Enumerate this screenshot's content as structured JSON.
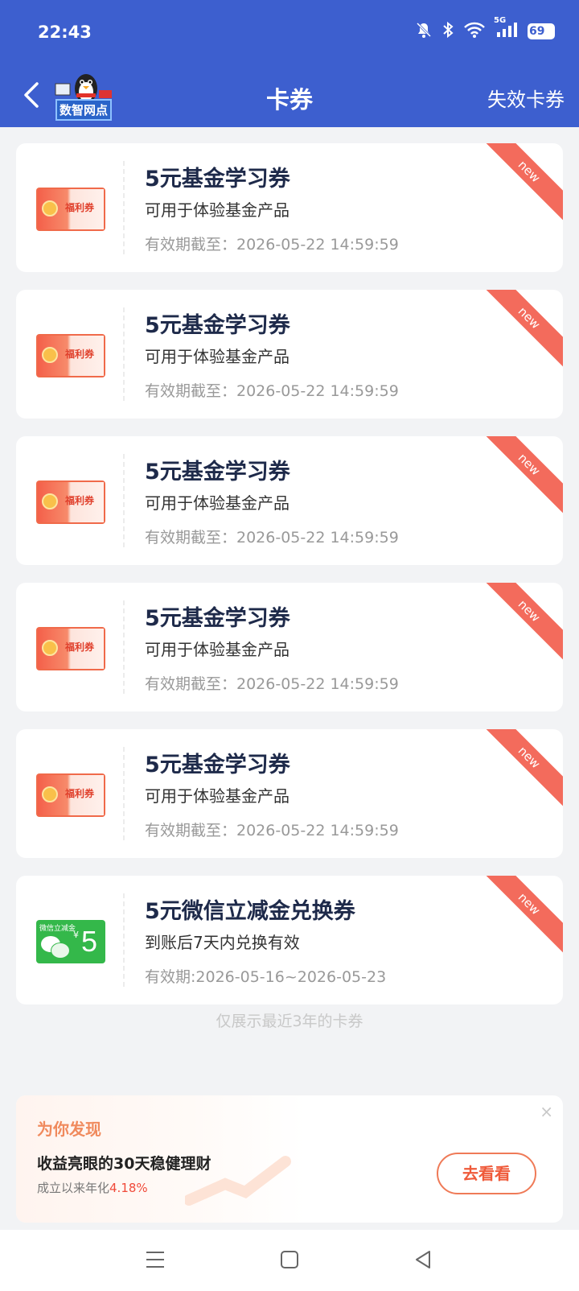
{
  "status_bar": {
    "time": "22:43",
    "network": "5G",
    "battery": "69"
  },
  "header": {
    "title": "卡券",
    "right_link": "失效卡券",
    "logo_text": "数智网点"
  },
  "coupons": [
    {
      "title": "5元基金学习券",
      "desc": "可用于体验基金产品",
      "expiry": "有效期截至：2026-05-22 14:59:59",
      "badge": "new",
      "image_label": "福利券",
      "image_type": "red"
    },
    {
      "title": "5元基金学习券",
      "desc": "可用于体验基金产品",
      "expiry": "有效期截至：2026-05-22 14:59:59",
      "badge": "new",
      "image_label": "福利券",
      "image_type": "red"
    },
    {
      "title": "5元基金学习券",
      "desc": "可用于体验基金产品",
      "expiry": "有效期截至：2026-05-22 14:59:59",
      "badge": "new",
      "image_label": "福利券",
      "image_type": "red"
    },
    {
      "title": "5元基金学习券",
      "desc": "可用于体验基金产品",
      "expiry": "有效期截至：2026-05-22 14:59:59",
      "badge": "new",
      "image_label": "福利券",
      "image_type": "red"
    },
    {
      "title": "5元基金学习券",
      "desc": "可用于体验基金产品",
      "expiry": "有效期截至：2026-05-22 14:59:59",
      "badge": "new",
      "image_label": "福利券",
      "image_type": "red"
    },
    {
      "title": "5元微信立减金兑换券",
      "desc": "到账后7天内兑换有效",
      "expiry": "有效期:2026-05-16~2026-05-23",
      "badge": "new",
      "image_label": "微信立减金",
      "image_value": "5",
      "image_currency": "¥",
      "image_type": "green"
    }
  ],
  "footer_note": "仅展示最近3年的卡券",
  "promo": {
    "tag": "为你发现",
    "title": "收益亮眼的30天稳健理财",
    "subtitle_prefix": "成立以来年化",
    "rate": "4.18%",
    "button": "去看看",
    "close": "×"
  },
  "colors": {
    "header": "#3d5fcf",
    "badge": "#f36b5c",
    "accent": "#ef5a3a"
  }
}
